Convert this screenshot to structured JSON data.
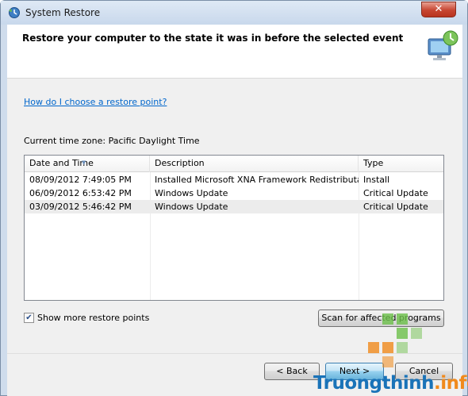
{
  "window": {
    "title": "System Restore",
    "close_glyph": "✕"
  },
  "header": {
    "heading": "Restore your computer to the state it was in before the selected event",
    "icon": "monitor-restore-icon"
  },
  "help_link": "How do I choose a restore point?",
  "timezone_label": "Current time zone: Pacific Daylight Time",
  "restore_points": {
    "columns": [
      "Date and Time",
      "Description",
      "Type"
    ],
    "rows": [
      {
        "date": "08/09/2012 7:49:05 PM",
        "description": "Installed Microsoft XNA Framework Redistributa...",
        "type": "Install"
      },
      {
        "date": "06/09/2012 6:53:42 PM",
        "description": "Windows Update",
        "type": "Critical Update"
      },
      {
        "date": "03/09/2012 5:46:42 PM",
        "description": "Windows Update",
        "type": "Critical Update"
      }
    ]
  },
  "show_more": {
    "label": "Show more restore points",
    "checked": true,
    "check_glyph": "✔"
  },
  "buttons": {
    "scan": "Scan for affected programs",
    "back": "< Back",
    "next": "Next >",
    "cancel": "Cancel"
  },
  "watermark": {
    "brand": "Truongthinh",
    "suffix": ".info",
    "colors": {
      "blue": "#1a73b8",
      "orange": "#f08a1c",
      "green": "#6cc04a"
    }
  }
}
